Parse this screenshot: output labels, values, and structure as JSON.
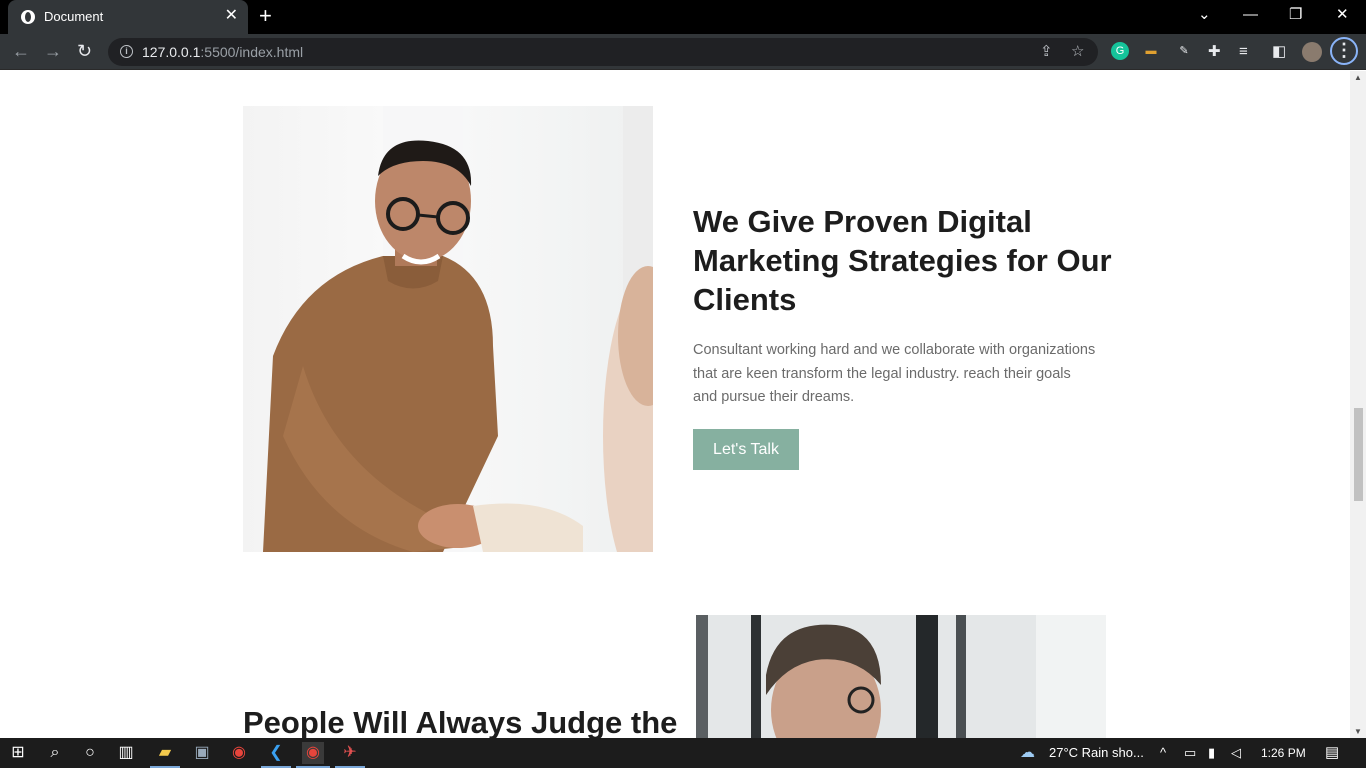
{
  "browser": {
    "tab_title": "Document",
    "tab_close": "✕",
    "new_tab": "+",
    "url_host": "127.0.0.1",
    "url_path": ":5500/index.html",
    "window_controls": {
      "dropdown": "⌄",
      "minimize": "—",
      "restore": "❐",
      "close": "✕"
    },
    "nav": {
      "back": "←",
      "forward": "→",
      "reload": "↻"
    },
    "extensions": {
      "grammarly": "G"
    },
    "menu": "⋮"
  },
  "page": {
    "section1": {
      "heading": "We Give Proven Digital Marketing Strategies for Our Clients",
      "paragraph": "Consultant working hard and we collaborate with organizations that are keen transform the legal industry. reach their goals and pursue their dreams.",
      "cta_label": "Let's Talk",
      "cta_color": "#86b0a0"
    },
    "section2": {
      "heading": "People Will Always Judge the"
    }
  },
  "taskbar": {
    "weather": "27°C  Rain sho...",
    "time": "1:26 PM"
  }
}
